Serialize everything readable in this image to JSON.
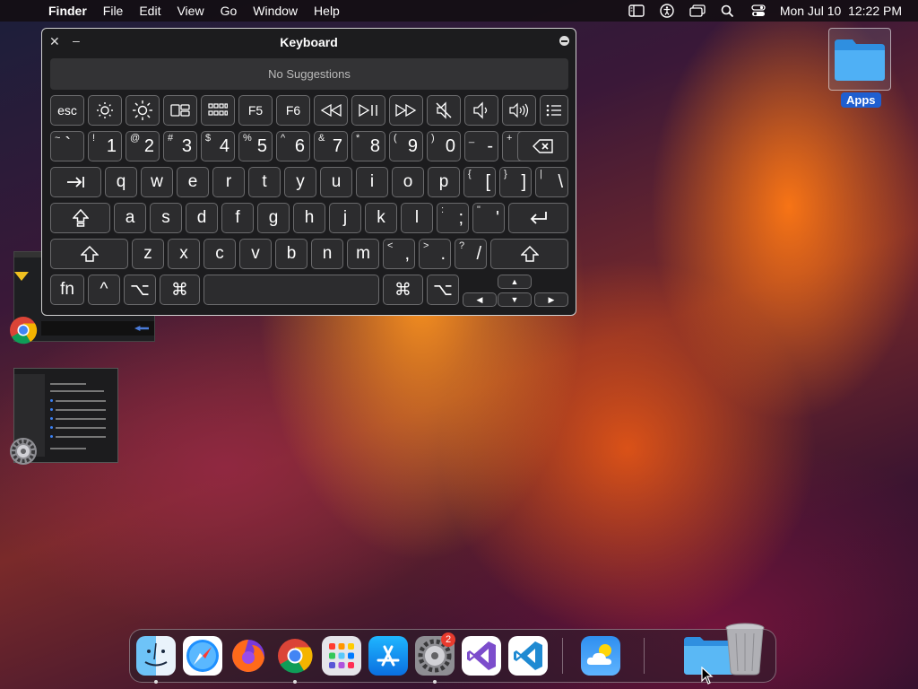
{
  "menubar": {
    "app_name": "Finder",
    "items": [
      "File",
      "Edit",
      "View",
      "Go",
      "Window",
      "Help"
    ],
    "clock": "Mon Jul 10  12:22 PM",
    "status_icons": [
      "sidebar-icon",
      "accessibility-icon",
      "window-switcher-icon",
      "spotlight-search-icon",
      "control-center-icon"
    ]
  },
  "keyboard": {
    "title": "Keyboard",
    "suggestions": "No Suggestions",
    "function_row": {
      "esc": "esc",
      "f5": "F5",
      "f6": "F6"
    },
    "number_row": [
      {
        "sub": "~",
        "main": "`"
      },
      {
        "sub": "!",
        "main": "1"
      },
      {
        "sub": "@",
        "main": "2"
      },
      {
        "sub": "#",
        "main": "3"
      },
      {
        "sub": "$",
        "main": "4"
      },
      {
        "sub": "%",
        "main": "5"
      },
      {
        "sub": "^",
        "main": "6"
      },
      {
        "sub": "&",
        "main": "7"
      },
      {
        "sub": "*",
        "main": "8"
      },
      {
        "sub": "(",
        "main": "9"
      },
      {
        "sub": ")",
        "main": "0"
      },
      {
        "sub": "_",
        "main": "-"
      },
      {
        "sub": "+",
        "main": "="
      }
    ],
    "row_q": [
      "q",
      "w",
      "e",
      "r",
      "t",
      "y",
      "u",
      "i",
      "o",
      "p"
    ],
    "row_q_extra": [
      {
        "sub": "{",
        "main": "["
      },
      {
        "sub": "}",
        "main": "]"
      },
      {
        "sub": "|",
        "main": "\\"
      }
    ],
    "row_a": [
      "a",
      "s",
      "d",
      "f",
      "g",
      "h",
      "j",
      "k",
      "l"
    ],
    "row_a_extra": [
      {
        "sub": ":",
        "main": ";"
      },
      {
        "sub": "\"",
        "main": "'"
      }
    ],
    "row_z": [
      "z",
      "x",
      "c",
      "v",
      "b",
      "n",
      "m"
    ],
    "row_z_extra": [
      {
        "sub": "<",
        "main": ","
      },
      {
        "sub": ">",
        "main": "."
      },
      {
        "sub": "?",
        "main": "/"
      }
    ],
    "bottom": {
      "fn": "fn",
      "control": "^",
      "option": "⌥",
      "command": "⌘",
      "arrow_up": "▲",
      "arrow_left": "◀",
      "arrow_down": "▼",
      "arrow_right": "▶"
    }
  },
  "desktop": {
    "folder_label": "Apps"
  },
  "dock": {
    "apps": [
      "Finder",
      "Safari",
      "Firefox",
      "Google Chrome",
      "Launchpad",
      "App Store",
      "System Settings",
      "Visual Studio",
      "Visual Studio Code",
      "Weather",
      "Downloads Folder",
      "Trash"
    ],
    "settings_badge": "2"
  },
  "colors": {
    "accent": "#1f5fd0",
    "badge": "#e83b2e",
    "key_bg": "#2c2c2e"
  }
}
